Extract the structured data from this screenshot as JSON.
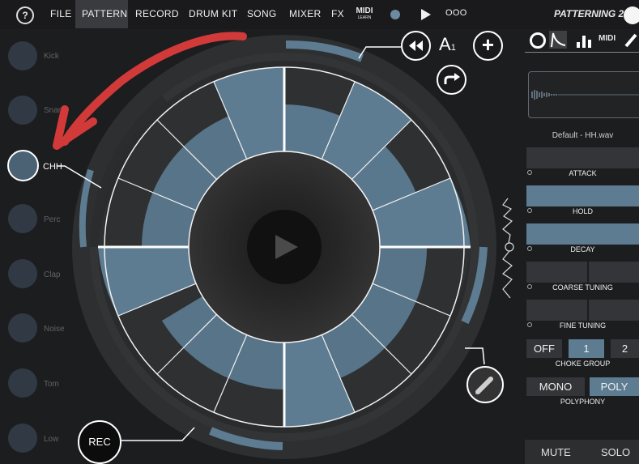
{
  "menu": {
    "help": "?",
    "items": [
      "FILE",
      "PATTERN",
      "RECORD",
      "DRUM KIT",
      "SONG",
      "MIXER",
      "FX"
    ],
    "midi_learn_top": "MIDI",
    "midi_learn_bottom": "LEARN",
    "more": "OOO",
    "active": "PATTERN",
    "title": "PATTERNING 2"
  },
  "tracks": [
    {
      "label": "Kick"
    },
    {
      "label": "Snare"
    },
    {
      "label": "CHH"
    },
    {
      "label": "Perc"
    },
    {
      "label": "Clap"
    },
    {
      "label": "Noise"
    },
    {
      "label": "Tom"
    },
    {
      "label": "Low"
    }
  ],
  "selected_track": "CHH",
  "center_controls": {
    "pattern_label": "A",
    "pattern_suffix": "1",
    "rec_label": "REC"
  },
  "sound_panel": {
    "tab_midi": "MIDI",
    "sample_name": "Default - HH.wav",
    "sliders": [
      {
        "label": "ATTACK",
        "level": 0.0
      },
      {
        "label": "HOLD",
        "level": 1.0
      },
      {
        "label": "DECAY",
        "level": 1.0
      },
      {
        "label": "COARSE TUNING",
        "level": 0.5
      },
      {
        "label": "FINE TUNING",
        "level": 0.5
      }
    ],
    "choke_group": {
      "label": "CHOKE GROUP",
      "options": [
        "OFF",
        "1",
        "2"
      ],
      "selected": "1"
    },
    "polyphony": {
      "label": "POLYPHONY",
      "options": [
        "MONO",
        "POLY"
      ],
      "selected": "POLY"
    },
    "mute_label": "MUTE",
    "solo_label": "SOLO"
  },
  "colors": {
    "accent": "#5d7c92",
    "background": "#1c1d1f",
    "annotation": "#d23a3a"
  }
}
